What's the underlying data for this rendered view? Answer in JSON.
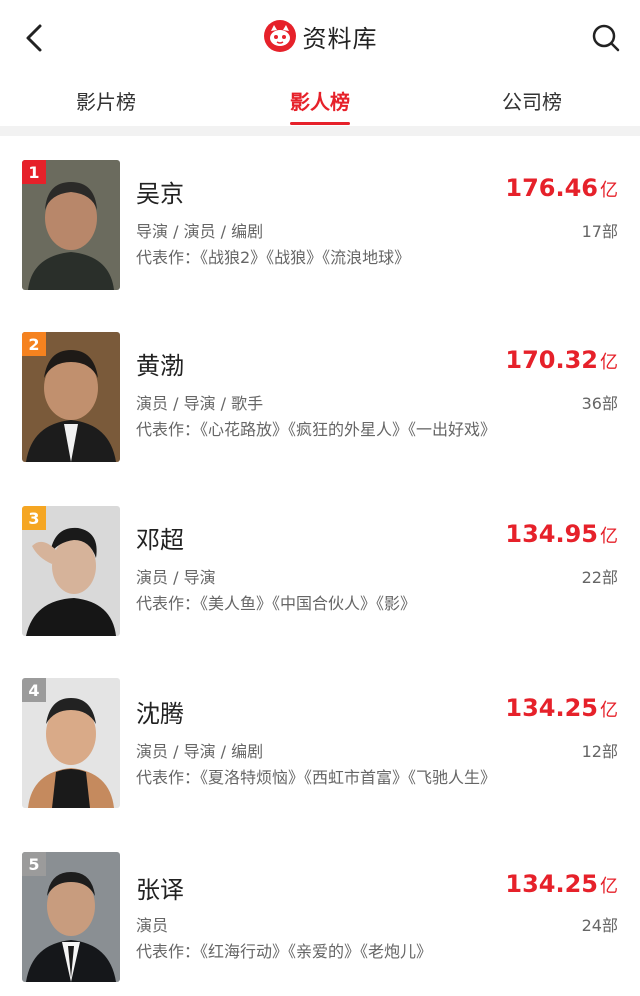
{
  "header": {
    "title": "资料库"
  },
  "tabs": [
    {
      "label": "影片榜"
    },
    {
      "label": "影人榜"
    },
    {
      "label": "公司榜"
    }
  ],
  "people": [
    {
      "rank": "1",
      "name": "吴京",
      "roles": "导演 / 演员 / 编剧",
      "works": "代表作：《战狼2》《战狼》《流浪地球》",
      "box_office": "176.46",
      "unit": "亿",
      "count": "17部",
      "rank_color": "#e6212a"
    },
    {
      "rank": "2",
      "name": "黄渤",
      "roles": "演员 / 导演 / 歌手",
      "works": "代表作：《心花路放》《疯狂的外星人》《一出好戏》",
      "box_office": "170.32",
      "unit": "亿",
      "count": "36部",
      "rank_color": "#f5821f"
    },
    {
      "rank": "3",
      "name": "邓超",
      "roles": "演员 / 导演",
      "works": "代表作：《美人鱼》《中国合伙人》《影》",
      "box_office": "134.95",
      "unit": "亿",
      "count": "22部",
      "rank_color": "#f5a623"
    },
    {
      "rank": "4",
      "name": "沈腾",
      "roles": "演员 / 导演 / 编剧",
      "works": "代表作：《夏洛特烦恼》《西虹市首富》《飞驰人生》",
      "box_office": "134.25",
      "unit": "亿",
      "count": "12部",
      "rank_color": "#9b9b9b"
    },
    {
      "rank": "5",
      "name": "张译",
      "roles": "演员",
      "works": "代表作：《红海行动》《亲爱的》《老炮儿》",
      "box_office": "134.25",
      "unit": "亿",
      "count": "24部",
      "rank_color": "#9b9b9b"
    }
  ],
  "colors": {
    "accent": "#e6212a"
  }
}
